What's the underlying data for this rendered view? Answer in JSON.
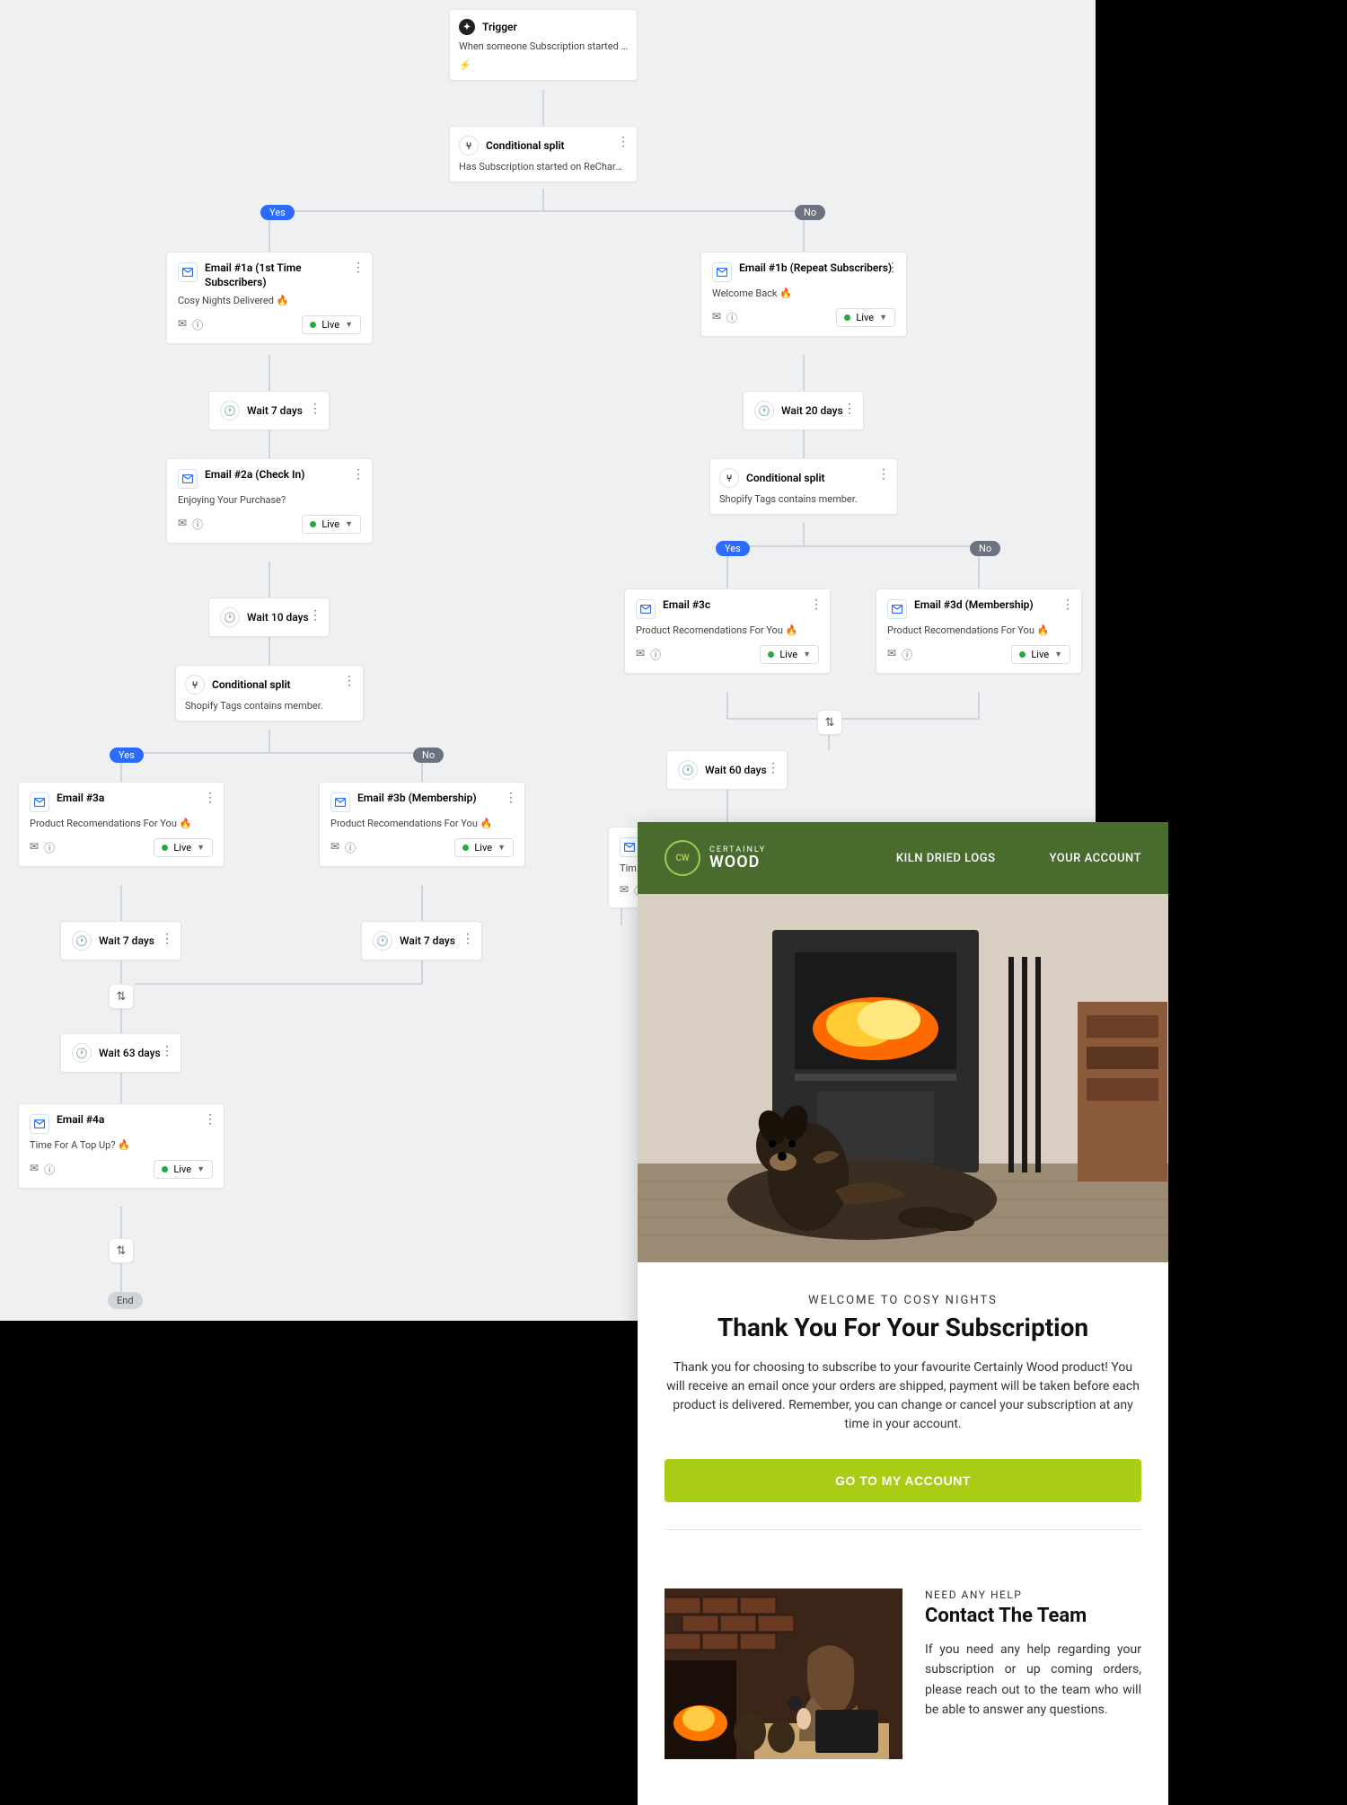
{
  "trigger": {
    "title": "Trigger",
    "desc": "When someone Subscription started on R..."
  },
  "cond1": {
    "title": "Conditional split",
    "desc": "Has Subscription started on ReCharge Is I..."
  },
  "pill_yes": "Yes",
  "pill_no": "No",
  "status_live": "Live",
  "end_label": "End",
  "email1a": {
    "title": "Email #1a (1st Time Subscribers)",
    "subj": "Cosy Nights Delivered 🔥"
  },
  "email1b": {
    "title": "Email #1b (Repeat Subscribers)",
    "subj": "Welcome Back 🔥"
  },
  "wait7": "Wait 7 days",
  "wait20": "Wait 20 days",
  "wait10": "Wait 10 days",
  "wait63": "Wait 63 days",
  "wait60": "Wait 60 days",
  "email2a": {
    "title": "Email #2a (Check In)",
    "subj": "Enjoying Your Purchase?"
  },
  "cond2": {
    "title": "Conditional split",
    "desc": "Shopify Tags contains member."
  },
  "cond3": {
    "title": "Conditional split",
    "desc": "Shopify Tags contains member."
  },
  "email3a": {
    "title": "Email #3a",
    "subj": "Product Recomendations For You 🔥"
  },
  "email3b": {
    "title": "Email #3b (Membership)",
    "subj": "Product Recomendations For You 🔥"
  },
  "email3c": {
    "title": "Email #3c",
    "subj": "Product Recomendations For You 🔥"
  },
  "email3d": {
    "title": "Email #3d (Membership)",
    "subj": "Product Recomendations For You 🔥"
  },
  "email4a": {
    "title": "Email #4a",
    "subj": "Time For A Top Up? 🔥"
  },
  "email4b_partial": "Tim...",
  "preview": {
    "nav1": "KILN DRIED LOGS",
    "nav2": "YOUR ACCOUNT",
    "logo_top": "CERTAINLY",
    "logo_bottom": "WOOD",
    "eyebrow": "WELCOME TO COSY NIGHTS",
    "headline": "Thank You For Your Subscription",
    "body": "Thank you for choosing to subscribe to your favourite Certainly Wood product! You will receive an email once your orders are shipped, payment will be taken before each product is delivered. Remember, you can change or cancel your subscription at any time in your account.",
    "cta": "GO TO MY ACCOUNT",
    "help_eyebrow": "NEED ANY HELP",
    "help_headline": "Contact The Team",
    "help_body": "If you need any help regarding your subscription or up coming orders, please reach out to the team who will be able to answer any questions."
  }
}
